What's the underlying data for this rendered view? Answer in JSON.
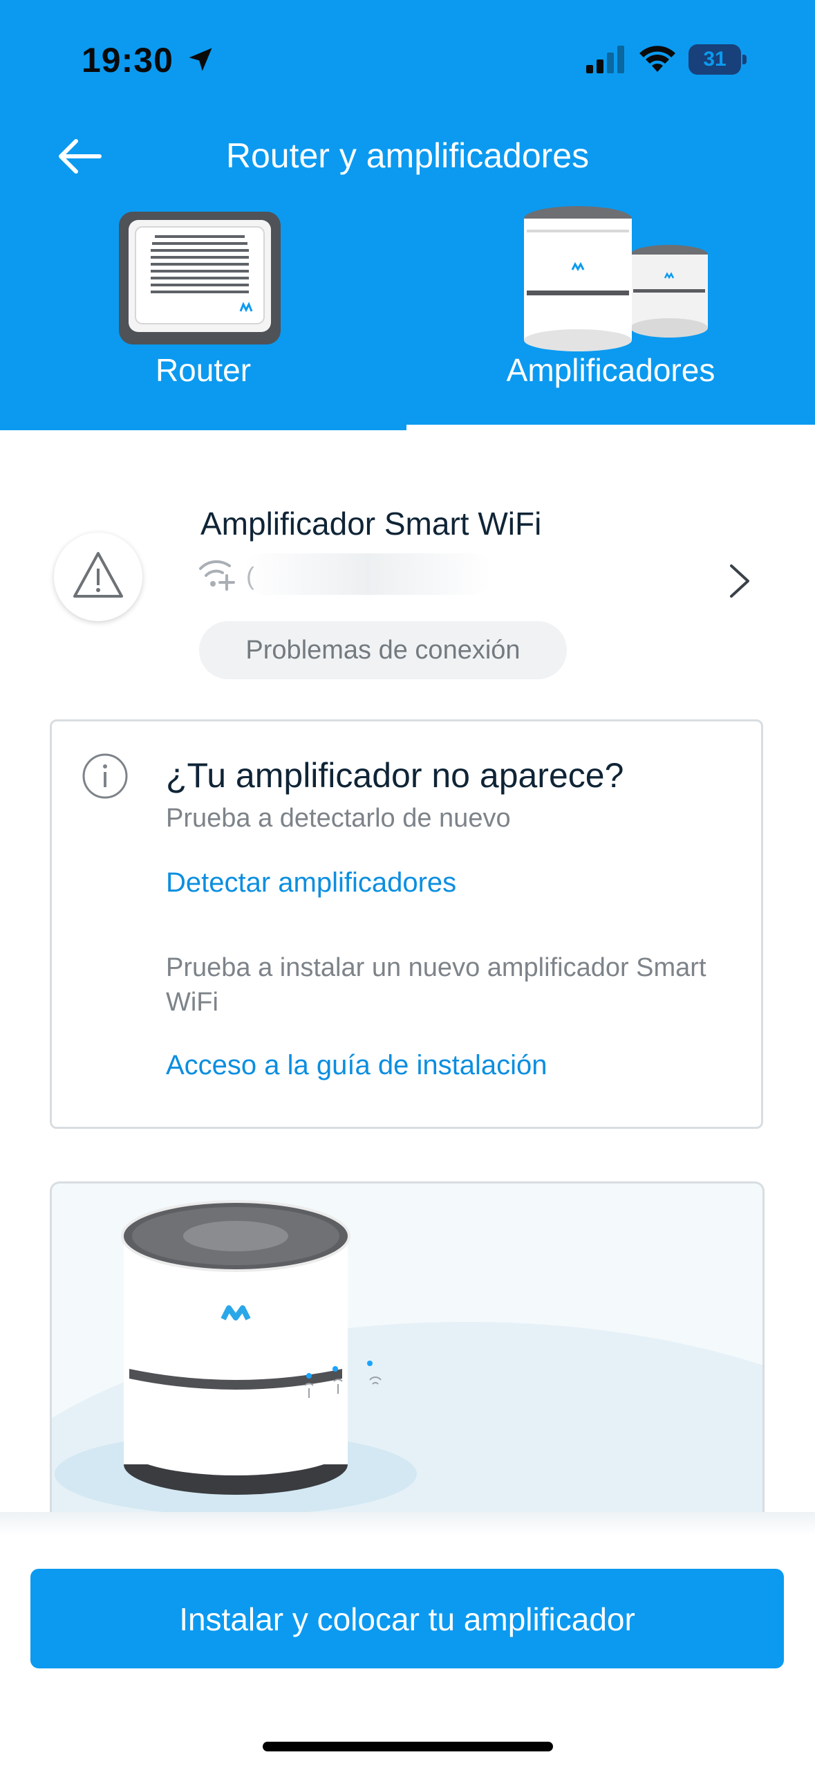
{
  "status_bar": {
    "time": "19:30",
    "battery": "31"
  },
  "header": {
    "title": "Router y amplificadores",
    "tabs": [
      {
        "label": "Router",
        "selected": false
      },
      {
        "label": "Amplificadores",
        "selected": true
      }
    ]
  },
  "device": {
    "name": "Amplificador Smart WiFi",
    "network_partial": "(",
    "badge": "Problemas de conexión"
  },
  "info_card": {
    "title": "¿Tu amplificador no aparece?",
    "subtitle": "Prueba a detectarlo de nuevo",
    "link_detect": "Detectar amplificadores",
    "install_text": "Prueba a instalar un nuevo amplificador Smart WiFi",
    "link_guide": "Acceso a la guía de instalación"
  },
  "primary_button": "Instalar y colocar tu amplificador",
  "colors": {
    "brand_blue": "#0b9af0",
    "link_blue": "#0b8ee0"
  },
  "icons": [
    "location-arrow-icon",
    "signal-icon",
    "wifi-icon",
    "battery-icon",
    "back-arrow-icon",
    "warning-icon",
    "wifi-plus-icon",
    "chevron-right-icon",
    "info-icon"
  ]
}
